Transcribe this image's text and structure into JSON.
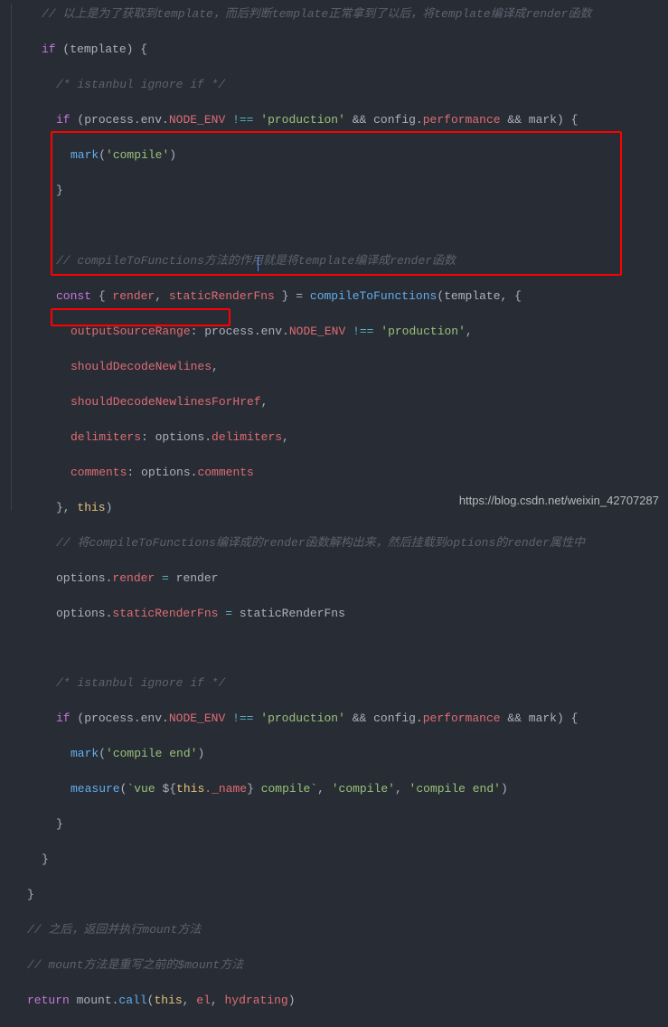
{
  "watermark": "https://blog.csdn.net/weixin_42707287",
  "lines": {
    "l01": "// 以上是为了获取到template，而后判断template正常拿到了以后，将template编译成render函数",
    "l02_if": "if",
    "l02_expr": "(template) {",
    "l03": "/* istanbul ignore if */",
    "l04_if": "if",
    "l04_a": "(process.env.",
    "l04_b": "NODE_ENV",
    "l04_c": " !== ",
    "l04_d": "'production'",
    "l04_e": " && config.",
    "l04_f": "performance",
    "l04_g": " && mark) {",
    "l05_fn": "mark",
    "l05_arg": "'compile'",
    "l06": "}",
    "l07": "",
    "l08": "// compileToFunctions方法的作用就是将template编译成render函数",
    "l09_const": "const",
    "l09_a": " { ",
    "l09_b": "render",
    "l09_c": ", ",
    "l09_d": "staticRenderFns",
    "l09_e": " } = ",
    "l09_f": "compileToFunctions",
    "l09_g": "(template, {",
    "l10_k": "outputSourceRange",
    "l10_a": ": process.env.",
    "l10_b": "NODE_ENV",
    "l10_c": " !== ",
    "l10_d": "'production'",
    "l10_e": ",",
    "l11": "shouldDecodeNewlines",
    "l11_e": ",",
    "l12": "shouldDecodeNewlinesForHref",
    "l12_e": ",",
    "l13_k": "delimiters",
    "l13_a": ": options.",
    "l13_b": "delimiters",
    "l13_e": ",",
    "l14_k": "comments",
    "l14_a": ": options.",
    "l14_b": "comments",
    "l15_a": "}, ",
    "l15_b": "this",
    "l15_c": ")",
    "l16": "// 将compileToFunctions编译成的render函数解构出来，然后挂载到options的render属性中",
    "l17_a": "options.",
    "l17_b": "render",
    "l17_c": " = ",
    "l17_d": "render",
    "l18_a": "options.",
    "l18_b": "staticRenderFns",
    "l18_c": " = ",
    "l18_d": "staticRenderFns",
    "l19": "",
    "l20": "/* istanbul ignore if */",
    "l21_if": "if",
    "l21_a": "(process.env.",
    "l21_b": "NODE_ENV",
    "l21_c": " !== ",
    "l21_d": "'production'",
    "l21_e": " && config.",
    "l21_f": "performance",
    "l21_g": " && mark) {",
    "l22_fn": "mark",
    "l22_arg": "'compile end'",
    "l23_fn": "measure",
    "l23_a": "(",
    "l23_b": "`vue ",
    "l23_c": "${",
    "l23_d": "this",
    "l23_d2": "._name",
    "l23_e": "}",
    "l23_f": " compile`",
    "l23_g": ", ",
    "l23_h": "'compile'",
    "l23_i": ", ",
    "l23_j": "'compile end'",
    "l23_k": ")",
    "l24": "}",
    "l25": "}",
    "l26": "}",
    "l27": "// 之后，返回并执行mount方法",
    "l28": "// mount方法是重写之前的$mount方法",
    "l29_a": "return",
    "l29_b": " mount.",
    "l29_c": "call",
    "l29_d": "(",
    "l29_e": "this",
    "l29_f": ", ",
    "l29_g": "el",
    "l29_h": ", ",
    "l29_i": "hydrating",
    "l29_j": ")"
  }
}
